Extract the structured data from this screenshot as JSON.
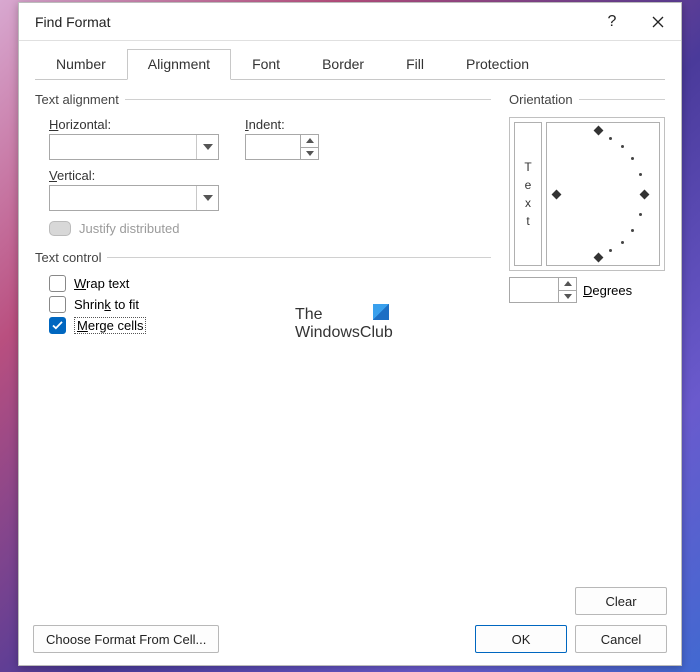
{
  "title": "Find Format",
  "tabs": [
    "Number",
    "Alignment",
    "Font",
    "Border",
    "Fill",
    "Protection"
  ],
  "activeTab": 1,
  "textAlign": {
    "group": "Text alignment",
    "horizontal_lbl": "Horizontal:",
    "horizontal_val": "",
    "vertical_lbl": "Vertical:",
    "vertical_val": "",
    "indent_lbl": "Indent:",
    "indent_val": "",
    "justify": "Justify distributed"
  },
  "textControl": {
    "group": "Text control",
    "wrap": "Wrap text",
    "shrink": "Shrink to fit",
    "merge": "Merge cells",
    "merge_checked": true
  },
  "orientation": {
    "group": "Orientation",
    "vtext": [
      "T",
      "e",
      "x",
      "t"
    ],
    "degrees_lbl": "Degrees",
    "degrees_val": ""
  },
  "watermark": {
    "l1": "The",
    "l2": "WindowsClub"
  },
  "buttons": {
    "clear": "Clear",
    "choose": "Choose Format From Cell...",
    "ok": "OK",
    "cancel": "Cancel"
  }
}
